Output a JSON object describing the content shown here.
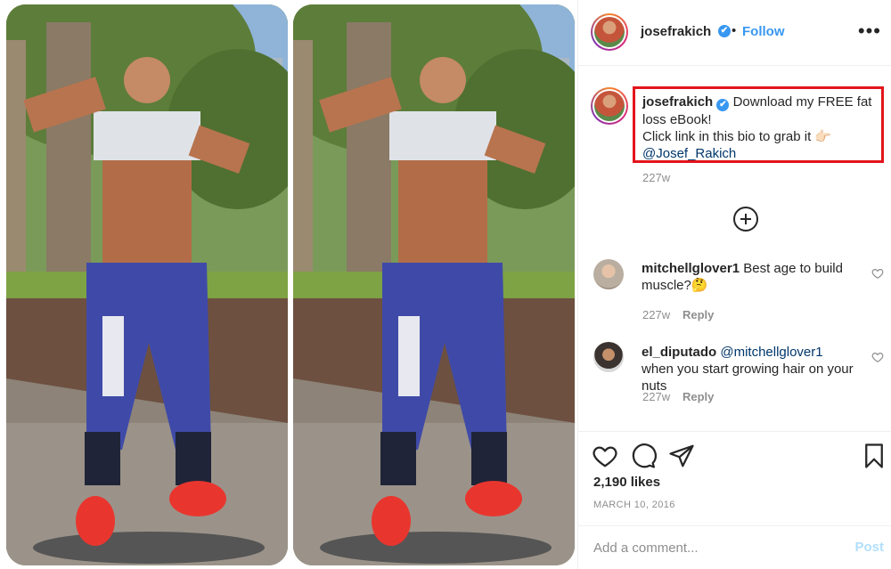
{
  "post": {
    "username": "josefrakich",
    "verified_icon": "✔",
    "follow_label": "Follow",
    "more_label": "•••",
    "dot": "•"
  },
  "caption": {
    "username": "josefrakich",
    "text_line1": "Download my FREE fat loss eBook!",
    "text_line2": "Click link in this bio to grab it 👉🏻",
    "mention": "@Josef_Rakich",
    "time": "227w"
  },
  "comments": [
    {
      "username": "mitchellglover1",
      "text": "Best age to build muscle?🤔",
      "time": "227w",
      "reply_label": "Reply"
    },
    {
      "username": "el_diputado",
      "mention": "@mitchellglover1",
      "text": "when you start growing hair on your nuts",
      "time": "227w",
      "reply_label": "Reply"
    }
  ],
  "likes": "2,190 likes",
  "date": "MARCH 10, 2016",
  "comment_box": {
    "placeholder": "Add a comment...",
    "post_label": "Post"
  },
  "icons": [
    "heart-icon",
    "comment-icon",
    "share-icon",
    "bookmark-icon",
    "plus-circle-icon",
    "more-icon",
    "verified-icon"
  ],
  "colors": {
    "accent": "#3897f0",
    "highlight_box": "#e3141b",
    "post_disabled": "#b2dffc"
  }
}
